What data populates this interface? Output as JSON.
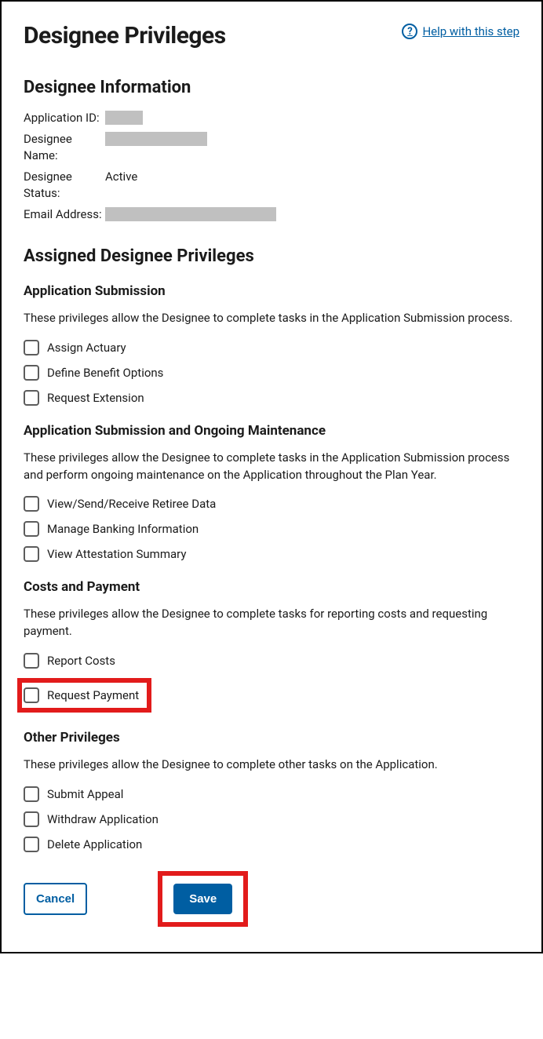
{
  "header": {
    "title": "Designee Privileges",
    "help_label": " Help with this step"
  },
  "designee_info": {
    "heading": "Designee Information",
    "rows": [
      {
        "label": "Application ID:",
        "value": "",
        "redact": "sm"
      },
      {
        "label": "Designee Name:",
        "value": "",
        "redact": "md"
      },
      {
        "label": "Designee Status:",
        "value": "Active",
        "redact": null
      },
      {
        "label": "Email Address:",
        "value": "",
        "redact": "lg"
      }
    ]
  },
  "privileges": {
    "heading": "Assigned Designee Privileges",
    "sections": [
      {
        "title": "Application Submission",
        "desc": "These privileges allow the Designee to complete tasks in the Application Submission process.",
        "items": [
          {
            "label": "Assign Actuary"
          },
          {
            "label": "Define Benefit Options"
          },
          {
            "label": "Request Extension"
          }
        ]
      },
      {
        "title": "Application Submission and Ongoing Maintenance",
        "desc": "These privileges allow the Designee to complete tasks in the Application Submission process and perform ongoing maintenance on the Application throughout the Plan Year.",
        "items": [
          {
            "label": "View/Send/Receive Retiree Data"
          },
          {
            "label": "Manage Banking Information"
          },
          {
            "label": "View Attestation Summary"
          }
        ]
      },
      {
        "title": "Costs and Payment",
        "desc": "These privileges allow the Designee to complete tasks for reporting costs and requesting payment.",
        "items": [
          {
            "label": "Report Costs"
          },
          {
            "label": "Request Payment",
            "highlight": true
          }
        ]
      },
      {
        "title": "Other Privileges",
        "desc": "These privileges allow the Designee to complete other tasks on the Application.",
        "items": [
          {
            "label": "Submit Appeal"
          },
          {
            "label": "Withdraw Application"
          },
          {
            "label": "Delete Application"
          }
        ]
      }
    ]
  },
  "buttons": {
    "cancel": "Cancel",
    "save": "Save"
  }
}
